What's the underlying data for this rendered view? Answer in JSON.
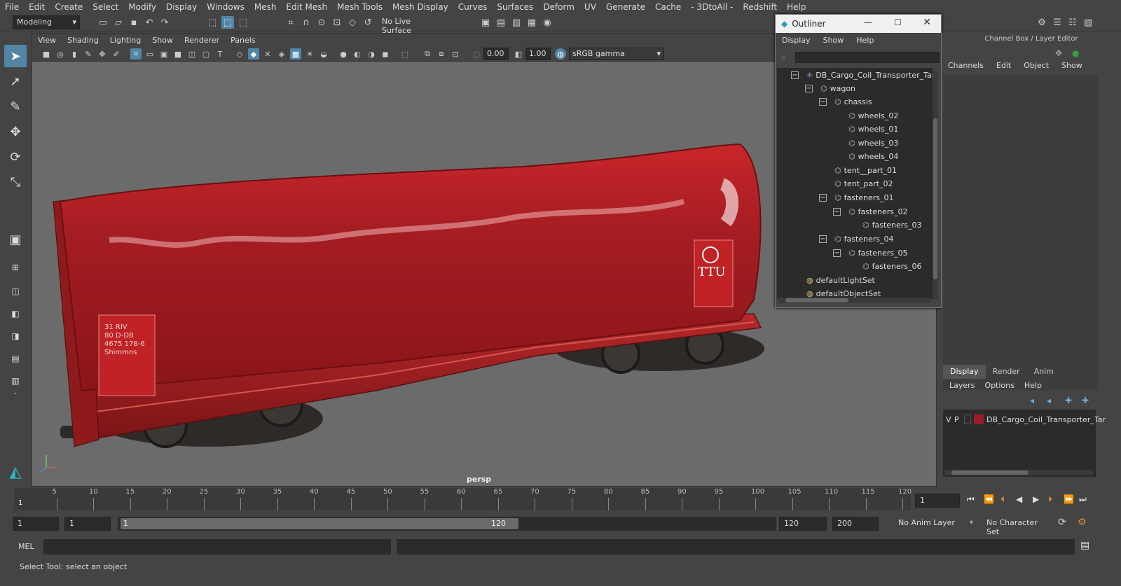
{
  "menubar": [
    "File",
    "Edit",
    "Create",
    "Select",
    "Modify",
    "Display",
    "Windows",
    "Mesh",
    "Edit Mesh",
    "Mesh Tools",
    "Mesh Display",
    "Curves",
    "Surfaces",
    "Deform",
    "UV",
    "Generate",
    "Cache",
    "- 3DtoAll -",
    "Redshift",
    "Help"
  ],
  "shelf": {
    "mode": "Modeling",
    "live_surface": "No Live Surface"
  },
  "viewport": {
    "menu": [
      "View",
      "Shading",
      "Lighting",
      "Show",
      "Renderer",
      "Panels"
    ],
    "field_a": "0.00",
    "field_b": "1.00",
    "color_space": "sRGB gamma",
    "camera_label": "persp",
    "wagon_text_ttu": "TTU",
    "wagon_text_plate": [
      "31 RIV",
      "80 D-DB",
      "4675 178-6",
      "Shimmns"
    ]
  },
  "outliner": {
    "title": "Outliner",
    "menu": [
      "Display",
      "Show",
      "Help"
    ],
    "items": [
      {
        "label": "DB_Cargo_Coil_Transporter_Tar",
        "kind": "root"
      },
      {
        "label": "wagon",
        "kind": "group"
      },
      {
        "label": "chassis",
        "kind": "group"
      },
      {
        "label": "wheels_02",
        "kind": "mesh"
      },
      {
        "label": "wheels_01",
        "kind": "mesh"
      },
      {
        "label": "wheels_03",
        "kind": "mesh"
      },
      {
        "label": "wheels_04",
        "kind": "mesh"
      },
      {
        "label": "tent__part_01",
        "kind": "mesh"
      },
      {
        "label": "tent_part_02",
        "kind": "mesh"
      },
      {
        "label": "fasteners_01",
        "kind": "group"
      },
      {
        "label": "fasteners_02",
        "kind": "group"
      },
      {
        "label": "fasteners_03",
        "kind": "mesh"
      },
      {
        "label": "fasteners_04",
        "kind": "group"
      },
      {
        "label": "fasteners_05",
        "kind": "group"
      },
      {
        "label": "fasteners_06",
        "kind": "mesh"
      },
      {
        "label": "defaultLightSet",
        "kind": "set"
      },
      {
        "label": "defaultObjectSet",
        "kind": "set"
      }
    ]
  },
  "channel_box": {
    "title": "Channel Box / Layer Editor",
    "menu": [
      "Channels",
      "Edit",
      "Object",
      "Show"
    ]
  },
  "layers": {
    "tabs": [
      "Display",
      "Render",
      "Anim"
    ],
    "menu": [
      "Layers",
      "Options",
      "Help"
    ],
    "row": {
      "v": "V",
      "p": "P",
      "name": "DB_Cargo_Coil_Transporter_Tar",
      "color": "#9b1c2a"
    }
  },
  "timeline": {
    "ticks": [
      "5",
      "10",
      "15",
      "20",
      "25",
      "30",
      "35",
      "40",
      "45",
      "50",
      "55",
      "60",
      "65",
      "70",
      "75",
      "80",
      "85",
      "90",
      "95",
      "100",
      "105",
      "110",
      "115",
      "120"
    ],
    "start_marker": "1",
    "current_frame": "1"
  },
  "range": {
    "start": "1",
    "playback_start": "1",
    "slider_start": "1",
    "slider_end": "120",
    "playback_end": "120",
    "end": "200",
    "anim_layer": "No Anim Layer",
    "character_set": "No Character Set"
  },
  "mel": {
    "label": "MEL"
  },
  "status": {
    "text": "Select Tool: select an object"
  }
}
